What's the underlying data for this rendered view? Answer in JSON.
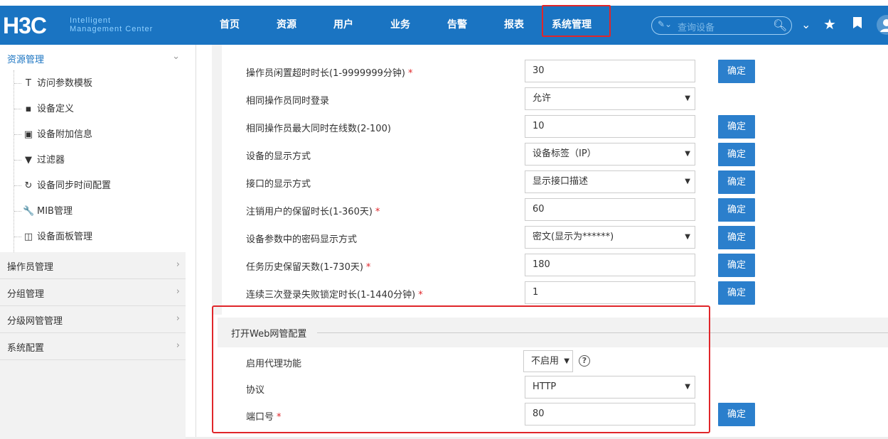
{
  "header": {
    "logo": "H3C",
    "logo_sub_line1": "Intelligent",
    "logo_sub_line2": "Management Center",
    "nav": [
      "首页",
      "资源",
      "用户",
      "业务",
      "告警",
      "报表",
      "系统管理"
    ],
    "active_nav": "系统管理",
    "search_placeholder": "查询设备",
    "icons": [
      "search-type-dropdown-icon",
      "search-icon",
      "double-chevron-down-icon",
      "star-icon",
      "bookmark-icon",
      "user-icon"
    ]
  },
  "sidebar": {
    "expanded_group": "资源管理",
    "sub_items": [
      {
        "label": "访问参数模板",
        "icon": "template-icon",
        "glyph": "T"
      },
      {
        "label": "设备定义",
        "icon": "device-define-icon",
        "glyph": "▪"
      },
      {
        "label": "设备附加信息",
        "icon": "device-info-icon",
        "glyph": "▣"
      },
      {
        "label": "过滤器",
        "icon": "filter-icon",
        "glyph": "▼"
      },
      {
        "label": "设备同步时间配置",
        "icon": "sync-icon",
        "glyph": "↻"
      },
      {
        "label": "MIB管理",
        "icon": "wrench-icon",
        "glyph": "🔧"
      },
      {
        "label": "设备面板管理",
        "icon": "panel-icon",
        "glyph": "◫"
      }
    ],
    "groups": [
      "操作员管理",
      "分组管理",
      "分级网管管理",
      "系统配置"
    ]
  },
  "form": {
    "rows": [
      {
        "label": "操作员闲置超时时长(1-9999999分钟)",
        "required": true,
        "type": "input",
        "value": "30",
        "button": "确定"
      },
      {
        "label": "相同操作员同时登录",
        "required": false,
        "type": "select",
        "value": "允许",
        "button": ""
      },
      {
        "label": "相同操作员最大同时在线数(2-100)",
        "required": false,
        "type": "input",
        "value": "10",
        "button": "确定"
      },
      {
        "label": "设备的显示方式",
        "required": false,
        "type": "select",
        "value": "设备标签（IP）",
        "button": "确定"
      },
      {
        "label": "接口的显示方式",
        "required": false,
        "type": "select",
        "value": "显示接口描述",
        "button": "确定"
      },
      {
        "label": "注销用户的保留时长(1-360天)",
        "required": true,
        "type": "input",
        "value": "60",
        "button": "确定"
      },
      {
        "label": "设备参数中的密码显示方式",
        "required": false,
        "type": "select",
        "value": "密文(显示为******)",
        "button": "确定"
      },
      {
        "label": "任务历史保留天数(1-730天)",
        "required": true,
        "type": "input",
        "value": "180",
        "button": "确定"
      },
      {
        "label": "连续三次登录失败锁定时长(1-1440分钟)",
        "required": true,
        "type": "input",
        "value": "1",
        "button": "确定"
      }
    ],
    "required_mark": "*"
  },
  "web_section": {
    "title": "打开Web网管配置",
    "proxy_label": "启用代理功能",
    "proxy_value": "不启用",
    "help": "?",
    "protocol_label": "协议",
    "protocol_value": "HTTP",
    "port_label": "端口号",
    "port_required": true,
    "port_value": "80",
    "ok": "确定"
  },
  "colors": {
    "header_bg": "#1a74c2",
    "button_bg": "#2b7fcc",
    "highlight_red": "#e0262a",
    "sidebar_active": "#1a74c2"
  }
}
